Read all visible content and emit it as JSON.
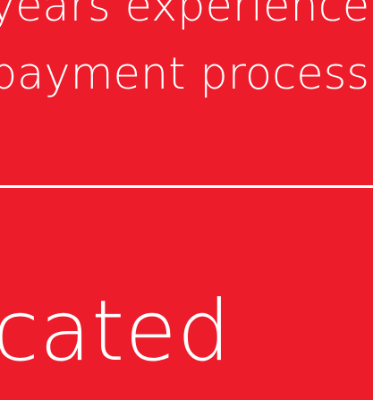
{
  "colors": {
    "background": "#ec1c2b",
    "text": "#ffffff",
    "divider": "#ffffff"
  },
  "content": {
    "line_1": "years experience",
    "line_2": "payment processi",
    "big_word": "cated"
  }
}
